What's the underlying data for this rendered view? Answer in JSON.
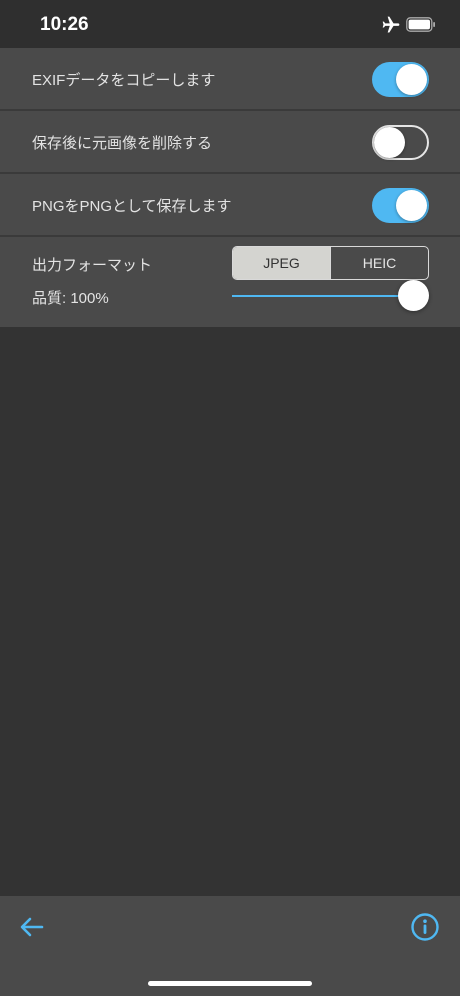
{
  "status_bar": {
    "time": "10:26",
    "icons": [
      "airplane-icon",
      "battery-icon"
    ]
  },
  "settings": {
    "rows": [
      {
        "label": "EXIFデータをコピーします",
        "enabled": true
      },
      {
        "label": "保存後に元画像を削除する",
        "enabled": false
      },
      {
        "label": "PNGをPNGとして保存します",
        "enabled": true
      }
    ],
    "output_format": {
      "label": "出力フォーマット",
      "options": [
        "JPEG",
        "HEIC"
      ],
      "selected": "JPEG"
    },
    "quality": {
      "label": "品質: 100%",
      "value_percent": 100
    }
  },
  "toolbar": {
    "back_icon": "arrow-left-icon",
    "info_icon": "info-icon"
  },
  "colors": {
    "accent": "#4fb8f2",
    "background": "#333333",
    "panel": "#4a4a4a"
  }
}
